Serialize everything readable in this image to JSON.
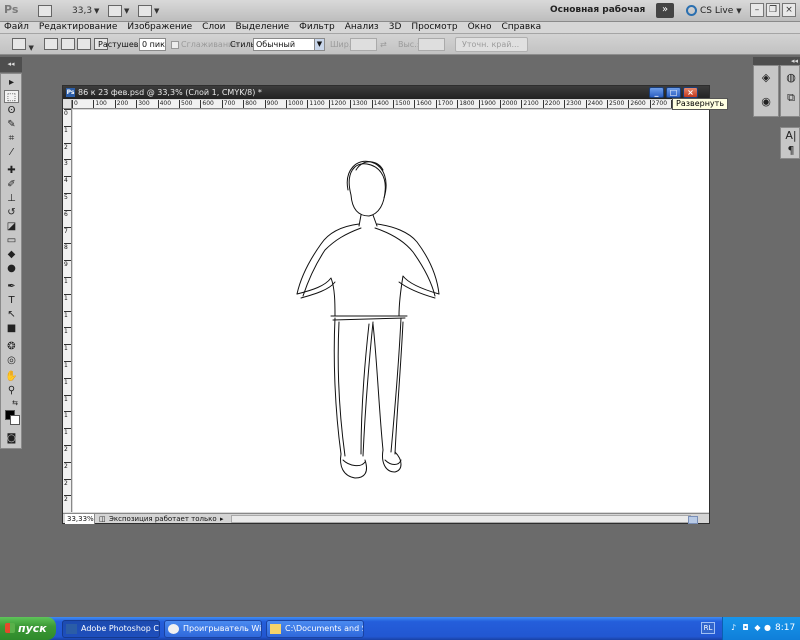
{
  "appbar": {
    "logo": "Ps",
    "zoom_value": "33,3",
    "workspace_label": "Основная рабочая среда",
    "expand_glyph": "»",
    "cs_live_label": "CS Live"
  },
  "menu": {
    "items": [
      "Файл",
      "Редактирование",
      "Изображение",
      "Слои",
      "Выделение",
      "Фильтр",
      "Анализ",
      "3D",
      "Просмотр",
      "Окно",
      "Справка"
    ]
  },
  "options": {
    "feather_label": "Растушевка:",
    "feather_value": "0 пикс",
    "antialias_label": "Сглаживание",
    "style_label": "Стиль:",
    "style_value": "Обычный",
    "width_label": "Шир.:",
    "height_label": "Выс.:",
    "refine_label": "Уточн. край..."
  },
  "tools": [
    {
      "name": "move-tool",
      "glyph": "▸"
    },
    {
      "name": "marquee-tool",
      "glyph": "⬚"
    },
    {
      "name": "lasso-tool",
      "glyph": "ʘ"
    },
    {
      "name": "quick-select-tool",
      "glyph": "✎"
    },
    {
      "name": "crop-tool",
      "glyph": "⌗"
    },
    {
      "name": "eyedropper-tool",
      "glyph": "⁄"
    },
    {
      "name": "healing-tool",
      "glyph": "✚"
    },
    {
      "name": "brush-tool",
      "glyph": "✐"
    },
    {
      "name": "stamp-tool",
      "glyph": "⊥"
    },
    {
      "name": "history-brush-tool",
      "glyph": "↺"
    },
    {
      "name": "eraser-tool",
      "glyph": "◪"
    },
    {
      "name": "gradient-tool",
      "glyph": "▭"
    },
    {
      "name": "blur-tool",
      "glyph": "◆"
    },
    {
      "name": "dodge-tool",
      "glyph": "●"
    },
    {
      "name": "pen-tool",
      "glyph": "✒"
    },
    {
      "name": "type-tool",
      "glyph": "T"
    },
    {
      "name": "path-select-tool",
      "glyph": "↖"
    },
    {
      "name": "shape-tool",
      "glyph": "■"
    },
    {
      "name": "3d-rotate-tool",
      "glyph": "❂"
    },
    {
      "name": "3d-orbit-tool",
      "glyph": "◎"
    },
    {
      "name": "hand-tool",
      "glyph": "✋"
    },
    {
      "name": "zoom-tool",
      "glyph": "⚲"
    },
    {
      "name": "swap-colors-tool",
      "glyph": "⇆"
    },
    {
      "name": "quick-mask-tool",
      "glyph": "◙"
    }
  ],
  "document": {
    "title": "86 к 23 фев.psd @ 33,3% (Слой 1, CMYK/8) *",
    "tooltip": "Развернуть",
    "zoom": "33,33%",
    "status_info": "Экспозиция работает только в ...",
    "ruler_top": [
      "0",
      "100",
      "200",
      "300",
      "400",
      "500",
      "600",
      "700",
      "800",
      "900",
      "1000",
      "1100",
      "1200",
      "1300",
      "1400",
      "1500",
      "1600",
      "1700",
      "1800",
      "1900",
      "2000",
      "2100",
      "2200",
      "2300",
      "2400",
      "2500",
      "2600",
      "2700",
      "2800",
      "2900"
    ],
    "ruler_left": [
      "0",
      "1",
      "2",
      "3",
      "4",
      "5",
      "6",
      "7",
      "8",
      "9",
      "1",
      "1",
      "1",
      "1",
      "1",
      "1",
      "1",
      "1",
      "1",
      "1",
      "2",
      "2",
      "2",
      "2"
    ]
  },
  "taskbar": {
    "start_label": "пуск",
    "tasks": [
      {
        "label": "Adobe Photoshop CS..."
      },
      {
        "label": "Проигрыватель Win..."
      },
      {
        "label": "C:\\Documents and Se..."
      }
    ],
    "lang": "RL",
    "clock": "8:17"
  },
  "colors": {
    "foreground": "#000000",
    "background": "#ffffff",
    "taskbar": "#245edb"
  }
}
